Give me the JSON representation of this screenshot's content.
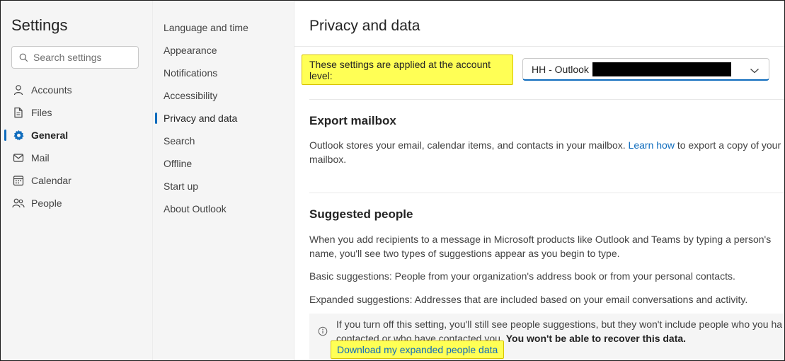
{
  "sidebar": {
    "title": "Settings",
    "search_placeholder": "Search settings",
    "items": [
      {
        "label": "Accounts",
        "icon": "person-icon"
      },
      {
        "label": "Files",
        "icon": "file-icon"
      },
      {
        "label": "General",
        "icon": "gear-icon",
        "active": true
      },
      {
        "label": "Mail",
        "icon": "mail-icon"
      },
      {
        "label": "Calendar",
        "icon": "calendar-icon"
      },
      {
        "label": "People",
        "icon": "people-icon"
      }
    ]
  },
  "subnav": {
    "items": [
      {
        "label": "Language and time"
      },
      {
        "label": "Appearance"
      },
      {
        "label": "Notifications"
      },
      {
        "label": "Accessibility"
      },
      {
        "label": "Privacy and data",
        "active": true
      },
      {
        "label": "Search"
      },
      {
        "label": "Offline"
      },
      {
        "label": "Start up"
      },
      {
        "label": "About Outlook"
      }
    ]
  },
  "main": {
    "title": "Privacy and data",
    "account_level_label": "These settings are applied at the account level:",
    "account_select_value": "HH - Outlook",
    "export": {
      "title": "Export mailbox",
      "text_before": "Outlook stores your email, calendar items, and contacts in your mailbox. ",
      "link": "Learn how",
      "text_after_line1": " to export a copy of your",
      "text_line2": "mailbox."
    },
    "suggested": {
      "title": "Suggested people",
      "para1_line1": "When you add recipients to a message in Microsoft products like Outlook and Teams by typing a person's",
      "para1_line2": "name, you'll see two types of suggestions appear as you begin to type.",
      "para2": "Basic suggestions: People from your organization's address book or from your personal contacts.",
      "para3": "Expanded suggestions: Addresses that are included based on your email conversations and activity.",
      "info_line1": "If you turn off this setting, you'll still see people suggestions, but they won't include people who you ha",
      "info_line2_normal": "contacted or who have contacted you. ",
      "info_line2_bold": "You won't be able to recover this data.",
      "download_link": "Download my expanded people data"
    }
  },
  "colors": {
    "accent": "#0f6cbd",
    "highlight": "#ffff55"
  }
}
